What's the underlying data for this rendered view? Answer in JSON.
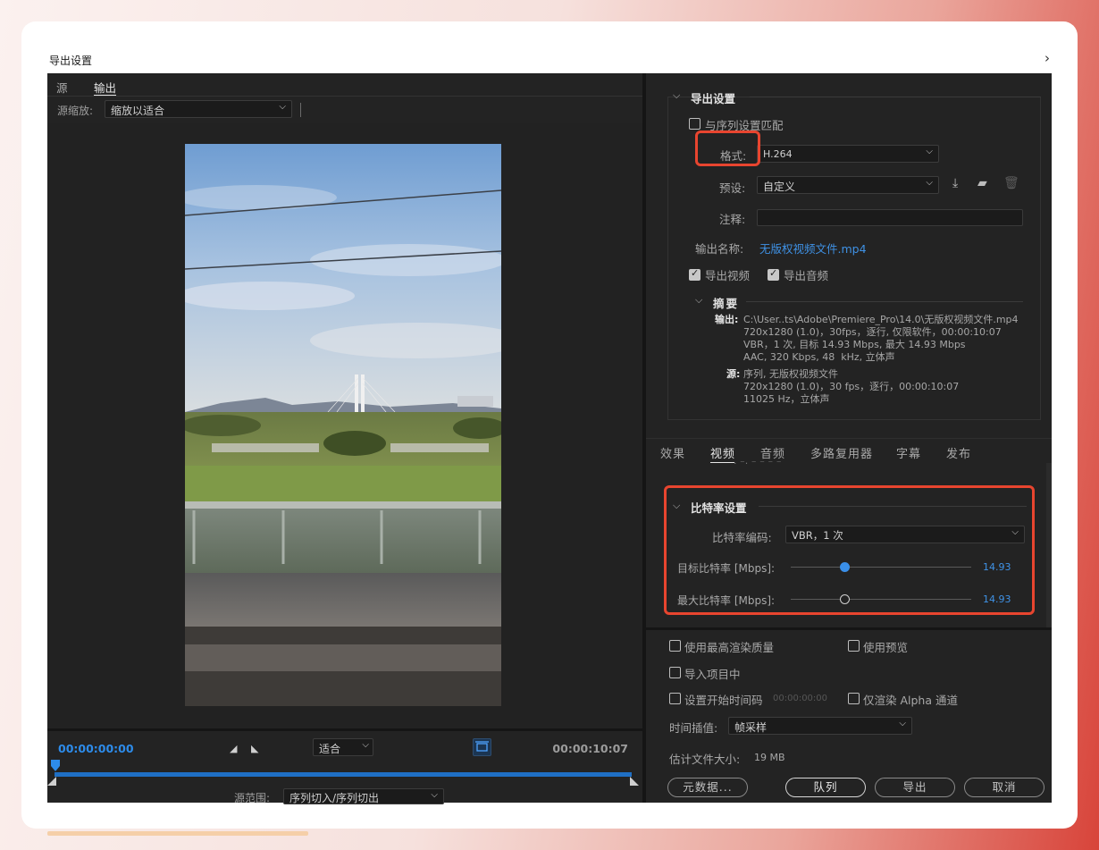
{
  "window": {
    "title": "导出设置",
    "close_glyph": "›"
  },
  "left": {
    "tabs": [
      "源",
      "输出"
    ],
    "active_tab": "输出",
    "source_scale_label": "源缩放:",
    "source_scale_value": "缩放以适合",
    "timecode_start": "00:00:00:00",
    "timecode_end": "00:00:10:07",
    "fit_value": "适合",
    "source_range_label": "源范围:",
    "source_range_value": "序列切入/序列切出"
  },
  "export_settings": {
    "section_title": "导出设置",
    "match_sequence_label": "与序列设置匹配",
    "match_sequence_checked": false,
    "format_label": "格式:",
    "format_value": "H.264",
    "preset_label": "预设:",
    "preset_value": "自定义",
    "comments_label": "注释:",
    "comments_value": "",
    "output_name_label": "输出名称:",
    "output_name_value": "无版权视频文件.mp4",
    "export_video_label": "导出视频",
    "export_video_checked": true,
    "export_audio_label": "导出音频",
    "export_audio_checked": true
  },
  "summary": {
    "title": "摘要",
    "output_label": "输出:",
    "output_lines": [
      "C:\\User..ts\\Adobe\\Premiere_Pro\\14.0\\无版权视频文件.mp4",
      "720x1280 (1.0)，30fps，逐行, 仅限软件，00:00:10:07",
      "VBR，1 次, 目标 14.93 Mbps, 最大 14.93 Mbps",
      "AAC, 320 Kbps, 48  kHz, 立体声"
    ],
    "source_label": "源:",
    "source_lines": [
      "序列, 无版权视频文件",
      "720x1280 (1.0)，30 fps，逐行，00:00:10:07",
      "11025 Hz，立体声"
    ]
  },
  "right_tabs": [
    "效果",
    "视频",
    "音频",
    "多路复用器",
    "字幕",
    "发布"
  ],
  "active_right_tab": "视频",
  "bitrate": {
    "cut_off_text": "· ⁻· ⁻ ⁻ ⁻ ⁻",
    "section_title": "比特率设置",
    "encoding_label": "比特率编码:",
    "encoding_value": "VBR，1 次",
    "target_label": "目标比特率 [Mbps]:",
    "target_value": "14.93",
    "target_fraction": 0.3,
    "max_label": "最大比特率 [Mbps]:",
    "max_value": "14.93",
    "max_fraction": 0.3
  },
  "bottom": {
    "max_render_quality_label": "使用最高渲染质量",
    "use_previews_label": "使用预览",
    "import_into_project_label": "导入项目中",
    "set_start_timecode_label": "设置开始时间码",
    "start_timecode_value": "00:00:00:00",
    "render_alpha_label": "仅渲染 Alpha 通道",
    "time_interpolation_label": "时间插值:",
    "time_interpolation_value": "帧采样",
    "estimated_size_label": "估计文件大小:",
    "estimated_size_value": "19 MB",
    "buttons": {
      "metadata": "元数据...",
      "queue": "队列",
      "export": "导出",
      "cancel": "取消"
    }
  },
  "colors": {
    "accent_blue": "#3f92e6",
    "highlight_red": "#e8452f",
    "panel_bg": "#232323"
  }
}
